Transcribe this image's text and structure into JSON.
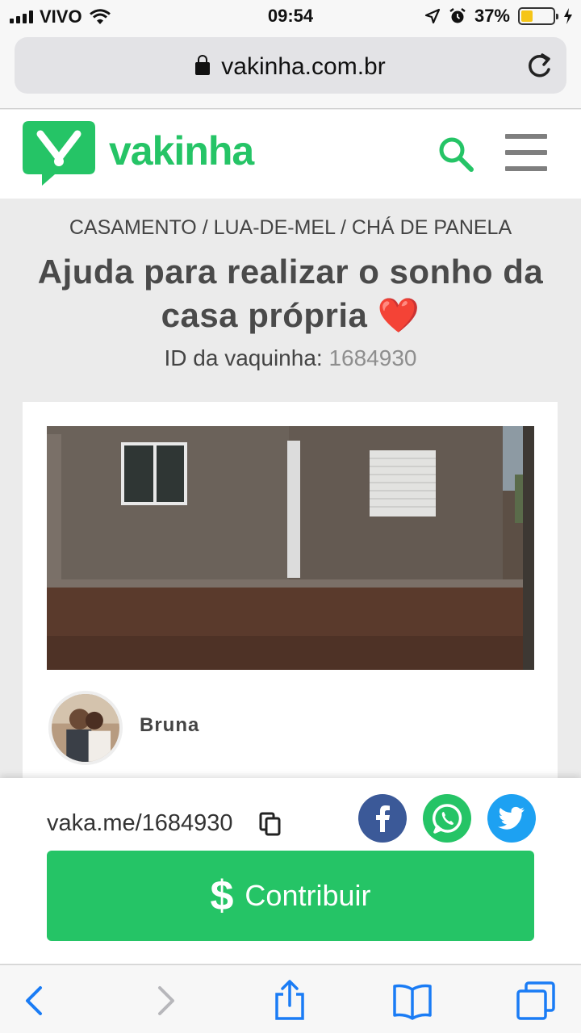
{
  "status_bar": {
    "carrier": "VIVO",
    "time": "09:54",
    "battery": "37%",
    "battery_level": 0.37
  },
  "browser": {
    "url": "vakinha.com.br"
  },
  "site": {
    "logo_text": "vakinha",
    "brand_color": "#25c466"
  },
  "campaign": {
    "category": "CASAMENTO / LUA-DE-MEL / CHÁ DE PANELA",
    "title": "Ajuda para realizar o sonho da casa própria",
    "title_emoji": "❤️",
    "id_label": "ID da vaquinha:",
    "id_value": "1684930",
    "author": "Bruna"
  },
  "share": {
    "short_link": "vaka.me/1684930",
    "facebook_icon": "facebook-icon",
    "whatsapp_icon": "whatsapp-icon",
    "twitter_icon": "twitter-icon"
  },
  "cta": {
    "symbol": "$",
    "label": "Contribuir"
  },
  "colors": {
    "green": "#25c466",
    "facebook": "#3b5998",
    "twitter": "#1da1f2",
    "ios_blue": "#1a7cf5"
  }
}
